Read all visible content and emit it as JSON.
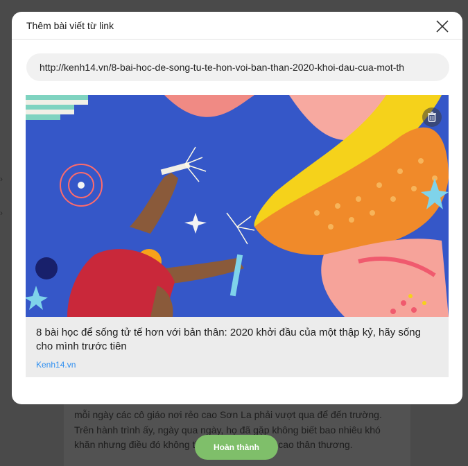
{
  "modal": {
    "title": "Thêm bài viết từ link",
    "url_value": "http://kenh14.vn/8-bai-hoc-de-song-tu-te-hon-voi-ban-than-2020-khoi-dau-cua-mot-th"
  },
  "preview": {
    "title": "8 bài học để sống tử tế hơn với bản thân: 2020 khởi đầu của một thập kỷ, hãy sống cho mình trước tiên",
    "source": "Kenh14.vn"
  },
  "background": {
    "body_text": "mỗi ngày các cô giáo nơi rẻo cao Sơn La phải vượt qua để đến trường. Trên hành trình ấy, ngày qua ngày, họ đã gặp không biết bao nhiêu khó khăn nhưng điều đó không thể ng               học trò vùng cao thân thương."
  },
  "footer": {
    "done_label": "Hoàn thành"
  },
  "colors": {
    "accent_green": "#7fbf6a",
    "link_blue": "#2f8ff0"
  },
  "icons": {
    "close": "close-icon",
    "delete": "trash-icon"
  }
}
